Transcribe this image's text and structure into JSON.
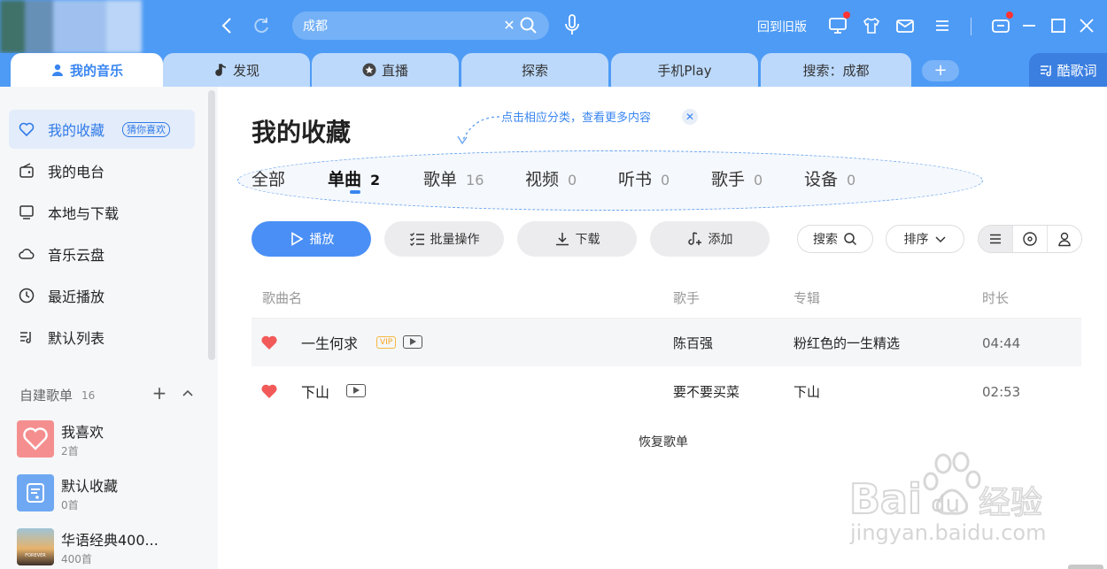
{
  "titlebar": {
    "search_value": "成都",
    "old_version": "回到旧版"
  },
  "tabs": [
    {
      "label": "我的音乐"
    },
    {
      "label": "发现"
    },
    {
      "label": "直播"
    },
    {
      "label": "探索"
    },
    {
      "label": "手机Play"
    },
    {
      "label": "搜索：成都"
    }
  ],
  "lyrics_tab": "酷歌词",
  "sidebar": {
    "items": [
      {
        "label": "我的收藏",
        "badge": "猜你喜欢"
      },
      {
        "label": "我的电台"
      },
      {
        "label": "本地与下载"
      },
      {
        "label": "音乐云盘"
      },
      {
        "label": "最近播放"
      },
      {
        "label": "默认列表"
      }
    ],
    "playlists_header": "自建歌单",
    "playlists_count": "16",
    "playlists": [
      {
        "name": "我喜欢",
        "sub": "2首"
      },
      {
        "name": "默认收藏",
        "sub": "0首"
      },
      {
        "name": "华语经典400...",
        "sub": "400首"
      }
    ],
    "cover_text": "FOREVER"
  },
  "main": {
    "title": "我的收藏",
    "hint": "点击相应分类，查看更多内容",
    "categories": [
      {
        "label": "全部",
        "count": ""
      },
      {
        "label": "单曲",
        "count": "2"
      },
      {
        "label": "歌单",
        "count": "16"
      },
      {
        "label": "视频",
        "count": "0"
      },
      {
        "label": "听书",
        "count": "0"
      },
      {
        "label": "歌手",
        "count": "0"
      },
      {
        "label": "设备",
        "count": "0"
      }
    ],
    "buttons": {
      "play": "播放",
      "batch": "批量操作",
      "download": "下载",
      "add": "添加",
      "search": "搜索",
      "sort": "排序"
    },
    "columns": {
      "song": "歌曲名",
      "artist": "歌手",
      "album": "专辑",
      "duration": "时长"
    },
    "songs": [
      {
        "title": "一生何求",
        "vip": "VIP",
        "artist": "陈百强",
        "album": "粉红色的一生精选",
        "duration": "04:44"
      },
      {
        "title": "下山",
        "artist": "要不要买菜",
        "album": "下山",
        "duration": "02:53"
      }
    ],
    "restore": "恢复歌单"
  },
  "watermark": {
    "text": "jingyan.baidu.com"
  },
  "colors": {
    "accent": "#4e9bf5",
    "active_text": "#2f7ae8",
    "heart": "#f25a5a",
    "vip": "#f5a623"
  }
}
